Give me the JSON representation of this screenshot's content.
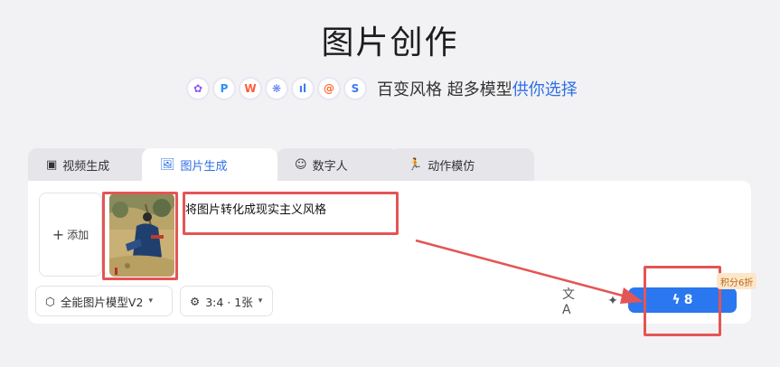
{
  "header": {
    "title": "图片创作",
    "subtitle_main": "百变风格 超多模型",
    "subtitle_accent": "供你选择",
    "model_icons": [
      {
        "name": "model-icon-1",
        "glyph": "✿",
        "color": "#8a5cf5"
      },
      {
        "name": "model-icon-2",
        "glyph": "P",
        "color": "#2f8ff5"
      },
      {
        "name": "model-icon-3",
        "glyph": "W",
        "color": "#ff5a3c"
      },
      {
        "name": "model-icon-4",
        "glyph": "❋",
        "color": "#5a7cf7"
      },
      {
        "name": "model-icon-5",
        "glyph": "ıl",
        "color": "#3d7df0"
      },
      {
        "name": "model-icon-6",
        "glyph": "@",
        "color": "#ff6a2a"
      },
      {
        "name": "model-icon-7",
        "glyph": "S",
        "color": "#3a7af2"
      }
    ]
  },
  "tabs": [
    {
      "label": "视频生成",
      "icon": "video-icon",
      "active": false
    },
    {
      "label": "图片生成",
      "icon": "image-icon",
      "active": true
    },
    {
      "label": "数字人",
      "icon": "digital-human-icon",
      "active": false
    },
    {
      "label": "动作模仿",
      "icon": "motion-icon",
      "active": false
    }
  ],
  "editor": {
    "add_label": "添加",
    "prompt_text": "将图片转化成现实主义风格"
  },
  "toolbar": {
    "model_select": "全能图片模型V2",
    "ratio_select": "3:4 · 1张",
    "generate_cost": "8",
    "discount_badge": "积分6折"
  },
  "colors": {
    "accent": "#2f6ee6",
    "button": "#2b77f0",
    "annotation": "#e45555"
  }
}
